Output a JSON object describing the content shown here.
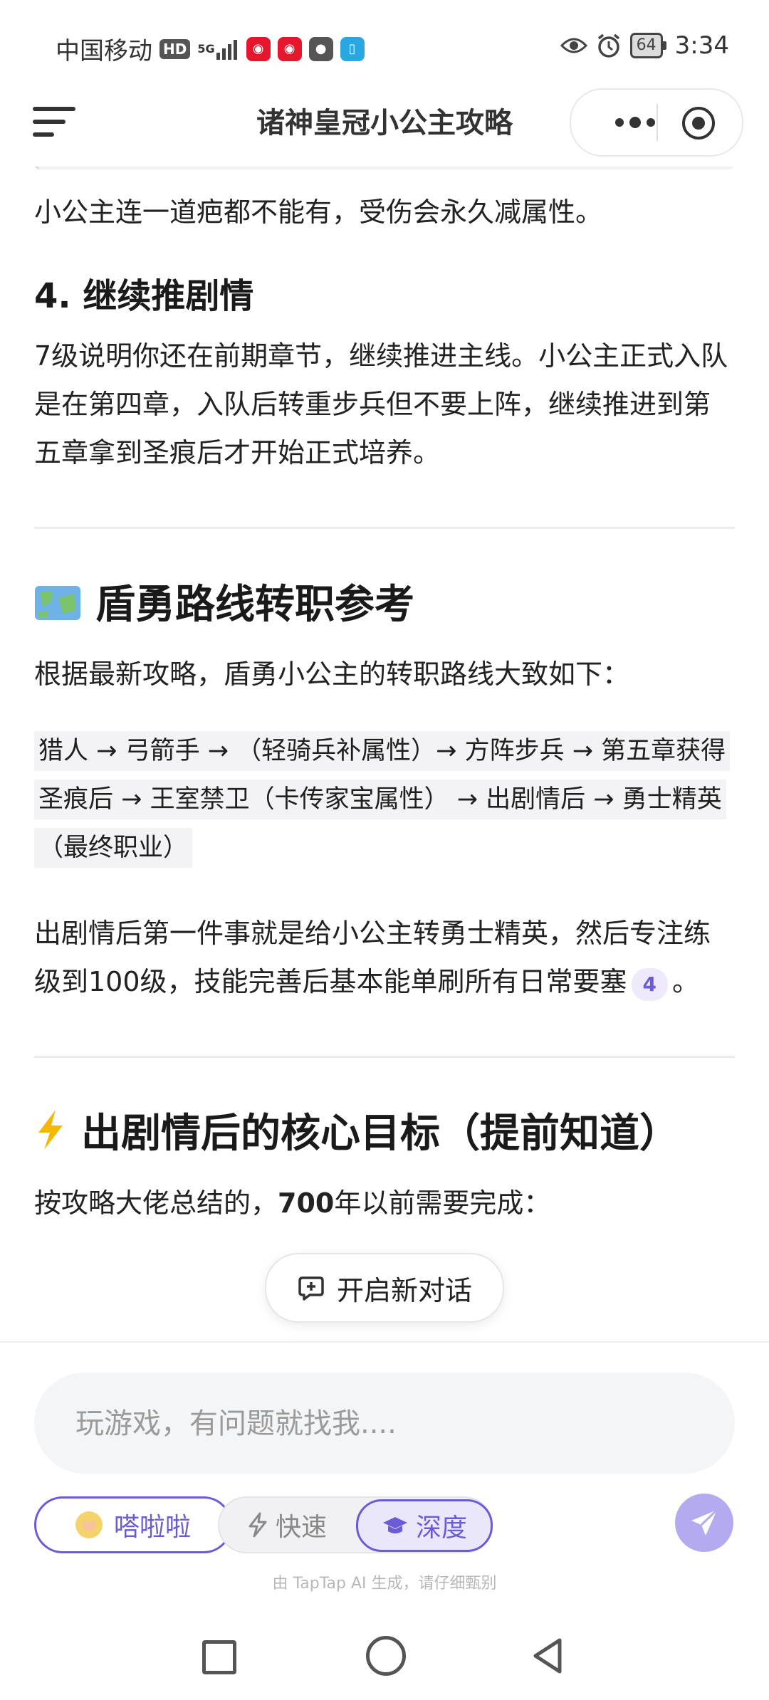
{
  "status_bar": {
    "carrier": "中国移动",
    "hd_badge": "HD",
    "signal_label": "5G",
    "battery": "64",
    "time": "3:34",
    "left_icons": [
      "weibo-icon",
      "weibo-icon",
      "wechat-icon",
      "book-app-icon"
    ],
    "right_icons": [
      "eye-icon",
      "alarm-icon",
      "battery-icon"
    ]
  },
  "header": {
    "title": "诸神皇冠小公主攻略"
  },
  "article": {
    "para_intro": "小公主连一道疤都不能有，受伤会永久减属性。",
    "h_continue": "4. 继续推剧情",
    "para_continue": "7级说明你还在前期章节，继续推进主线。小公主正式入队是在第四章，入队后转重步兵但不要上阵，继续推进到第五章拿到圣痕后才开始正式培养。",
    "section_route": {
      "icon": "map-emoji",
      "title": "盾勇路线转职参考",
      "para_lead": "根据最新攻略，盾勇小公主的转职路线大致如下：",
      "route_code": "猎人 → 弓箭手 → （轻骑兵补属性）→ 方阵步兵 → 第五章获得圣痕后 → 王室禁卫（卡传家宝属性） → 出剧情后 → 勇士精英（最终职业）",
      "para_after": "出剧情后第一件事就是给小公主转勇士精英，然后专注练级到100级，技能完善后基本能单刷所有日常要塞",
      "citation": "4",
      "para_after_end": "。"
    },
    "section_goal": {
      "icon": "lightning-emoji",
      "title": "出剧情后的核心目标（提前知道）",
      "para_lead_start": "按攻略大佬总结的，",
      "para_lead_bold": "700",
      "para_lead_end": "年以前需要完成："
    }
  },
  "new_chat_button": "开启新对话",
  "composer": {
    "placeholder": "玩游戏，有问题就找我....",
    "role_label": "嗒啦啦",
    "mode_fast": "快速",
    "mode_deep": "深度",
    "disclaimer": "由 TapTap AI 生成，请仔细甄别"
  },
  "colors": {
    "accent": "#6b5bd6",
    "send_button": "#b3aaf0"
  }
}
